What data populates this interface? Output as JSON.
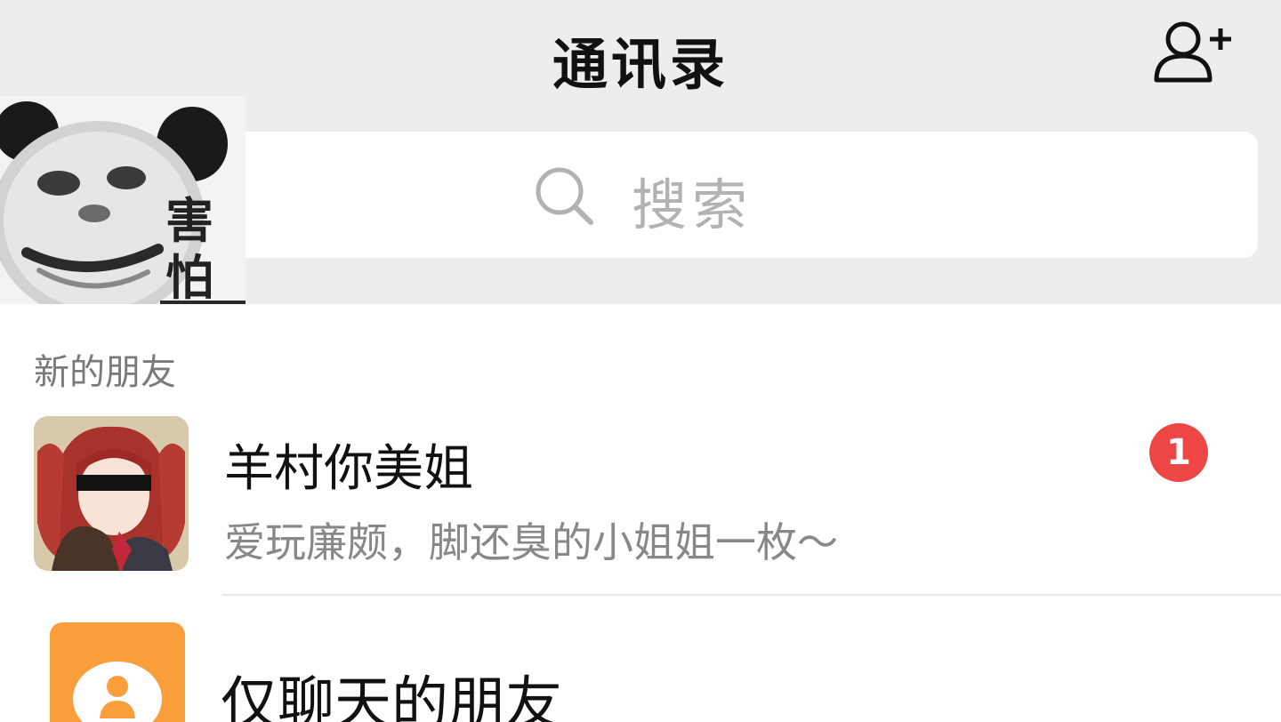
{
  "header": {
    "title": "通讯录",
    "add_icon": "add-contact-icon"
  },
  "search": {
    "placeholder": "搜索",
    "icon": "search-icon"
  },
  "sticker": {
    "line1": "害",
    "line2": "怕"
  },
  "section": {
    "label": "新的朋友"
  },
  "new_friend": {
    "name": "羊村你美姐",
    "description": "爱玩廉颇，脚还臭的小姐姐一枚～",
    "badge_count": "1"
  },
  "chat_only": {
    "label": "仅聊天的朋友"
  },
  "colors": {
    "background": "#ededed",
    "badge": "#ee4545",
    "chat_icon": "#fa9d3b"
  }
}
